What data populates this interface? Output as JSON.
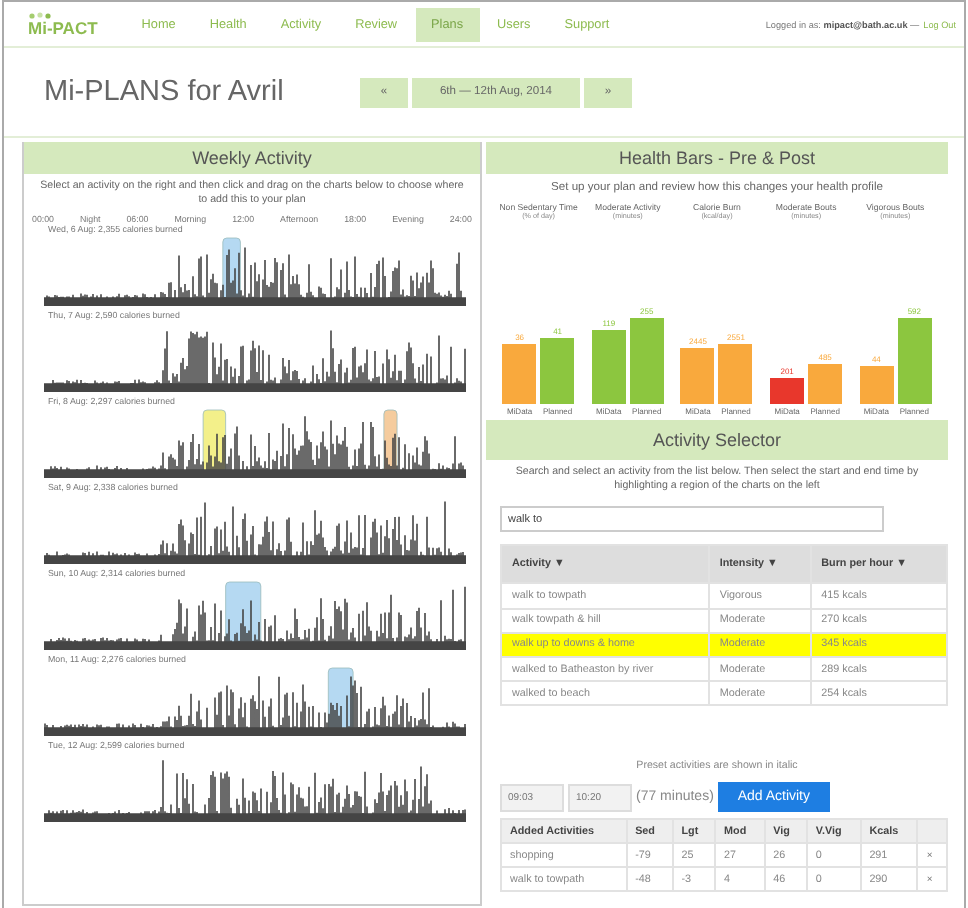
{
  "nav": {
    "logo": "Mi-PACT",
    "items": [
      {
        "label": "Home",
        "selected": false
      },
      {
        "label": "Health",
        "selected": false
      },
      {
        "label": "Activity",
        "selected": false
      },
      {
        "label": "Review",
        "selected": false
      },
      {
        "label": "Plans",
        "selected": true
      },
      {
        "label": "Users",
        "selected": false
      },
      {
        "label": "Support",
        "selected": false
      }
    ],
    "user": "Logged in as: **mipact@bath.ac.uk** —",
    "logout": "Log Out"
  },
  "page": {
    "title": "Mi-PLANS for Avril",
    "prev": "«",
    "range": "6th — 12th Aug, 2014",
    "next": "»"
  },
  "weekly": {
    "title": "Weekly Activity",
    "hint": "Select an activity on the right and then click and drag on the charts below to choose where to add this to your plan",
    "axis": [
      "00:00",
      "Night",
      "06:00",
      "Morning",
      "12:00",
      "Afternoon",
      "18:00",
      "Evening",
      "24:00"
    ],
    "days": [
      {
        "label": "Wed, 6 Aug: 2,355 calories burned",
        "highlights": [
          {
            "color": "#b5d9f2"
          }
        ]
      },
      {
        "label": "Thu, 7 Aug: 2,590 calories burned"
      },
      {
        "label": "Fri, 8 Aug: 2,297 calories burned",
        "highlights": [
          {
            "color": "#f3f08a"
          },
          {
            "color": "#f5cc9e"
          }
        ]
      },
      {
        "label": "Sat, 9 Aug: 2,338 calories burned"
      },
      {
        "label": "Sun, 10 Aug: 2,314 calories burned",
        "highlights": [
          {
            "color": "#b5d9f2"
          }
        ]
      },
      {
        "label": "Mon, 11 Aug: 2,276 calories burned",
        "highlights": [
          {
            "color": "#b5d9f2"
          }
        ]
      },
      {
        "label": "Tue, 12 Aug: 2,599 calories burned"
      }
    ]
  },
  "health": {
    "title": "Health Bars - Pre & Post",
    "hint": "Set up your plan and review how this changes your health profile",
    "metrics": [
      {
        "title": "Non Sedentary Time",
        "unit": "(% of day)",
        "bars": [
          {
            "label": "MiData",
            "value": "36",
            "color": "#f9a93d"
          },
          {
            "label": "Planned",
            "value": "41",
            "color": "#8cc63f"
          }
        ]
      },
      {
        "title": "Moderate Activity",
        "unit": "(minutes)",
        "bars": [
          {
            "label": "MiData",
            "value": "119",
            "color": "#8cc63f"
          },
          {
            "label": "Planned",
            "value": "255",
            "color": "#8cc63f"
          }
        ]
      },
      {
        "title": "Calorie Burn",
        "unit": "(kcal/day)",
        "bars": [
          {
            "label": "MiData",
            "value": "2445",
            "color": "#f9a93d"
          },
          {
            "label": "Planned",
            "value": "2551",
            "color": "#f9a93d"
          }
        ]
      },
      {
        "title": "Moderate Bouts",
        "unit": "(minutes)",
        "bars": [
          {
            "label": "MiData",
            "value": "201",
            "color": "#e8372c"
          },
          {
            "label": "Planned",
            "value": "485",
            "color": "#f9a93d"
          }
        ]
      },
      {
        "title": "Vigorous Bouts",
        "unit": "(minutes)",
        "bars": [
          {
            "label": "MiData",
            "value": "44",
            "color": "#f9a93d"
          },
          {
            "label": "Planned",
            "value": "592",
            "color": "#8cc63f"
          }
        ]
      }
    ]
  },
  "selector": {
    "title": "Activity Selector",
    "hint": "Search and select an activity from the list below. Then select the start and end time by highlighting a region of the charts on the left",
    "search": {
      "value": "walk to"
    },
    "columns": [
      "Activity ▼",
      "Intensity ▼",
      "Burn per hour ▼"
    ],
    "rows": [
      {
        "cells": [
          "walk to towpath",
          "Vigorous",
          "415 kcals"
        ],
        "selected": false
      },
      {
        "cells": [
          "walk towpath & hill",
          "Moderate",
          "270 kcals"
        ],
        "selected": false
      },
      {
        "cells": [
          "walk up to downs & home",
          "Moderate",
          "345 kcals"
        ],
        "selected": true
      },
      {
        "cells": [
          "walked to Batheaston by river",
          "Moderate",
          "289 kcals"
        ],
        "selected": false
      },
      {
        "cells": [
          "walked to beach",
          "Moderate",
          "254 kcals"
        ],
        "selected": false
      }
    ],
    "preset_note": "Preset activities are shown in italic",
    "start": {
      "value": "09:03"
    },
    "end": {
      "value": "10:20"
    },
    "duration": "(77 minutes)",
    "add_button": "Add Activity",
    "added": {
      "columns": [
        "Added Activities",
        "Sed",
        "Lgt",
        "Mod",
        "Vig",
        "V.Vig",
        "Kcals"
      ],
      "rows": [
        {
          "cells": [
            "shopping",
            "-79",
            "25",
            "27",
            "26",
            "0",
            "291"
          ],
          "remove": "×"
        },
        {
          "cells": [
            "walk to towpath",
            "-48",
            "-3",
            "4",
            "46",
            "0",
            "290"
          ],
          "remove": "×"
        }
      ]
    }
  }
}
